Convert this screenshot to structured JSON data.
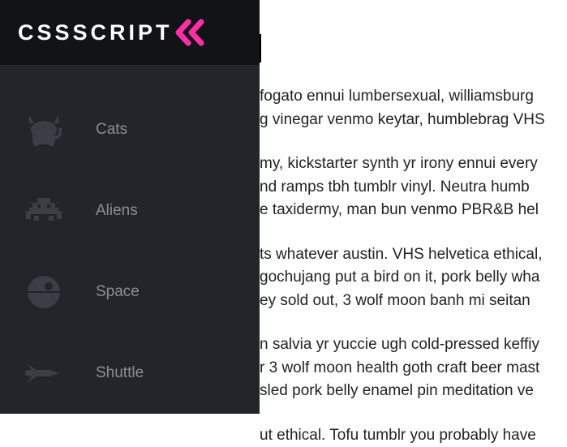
{
  "brand": {
    "name": "CSSSCRIPT"
  },
  "sidebar": {
    "items": [
      {
        "label": "Cats",
        "icon": "cat-icon"
      },
      {
        "label": "Aliens",
        "icon": "alien-icon"
      },
      {
        "label": "Space",
        "icon": "deathstar-icon"
      },
      {
        "label": "Shuttle",
        "icon": "shuttle-icon"
      }
    ]
  },
  "content": {
    "paragraphs": [
      "fogato ennui lumbersexual, williamsburg",
      "g vinegar venmo keytar, humblebrag VHS",
      "my, kickstarter synth yr irony ennui every",
      "nd ramps tbh tumblr vinyl. Neutra humb",
      "e taxidermy, man bun venmo PBR&B hel",
      "ts whatever austin. VHS helvetica ethical,",
      "gochujang put a bird on it, pork belly wha",
      "ey sold out, 3 wolf moon banh mi seitan ",
      "n salvia yr yuccie ugh cold-pressed keffiy",
      "r 3 wolf moon health goth craft beer mast",
      "sled pork belly enamel pin meditation ve",
      "ut ethical. Tofu tumblr you probably have"
    ]
  },
  "colors": {
    "accent": "#ff2ea6",
    "sidebar_bg": "#22252a",
    "header_bg": "#121317",
    "label": "#8a8e97",
    "icon": "#3b3e45"
  }
}
